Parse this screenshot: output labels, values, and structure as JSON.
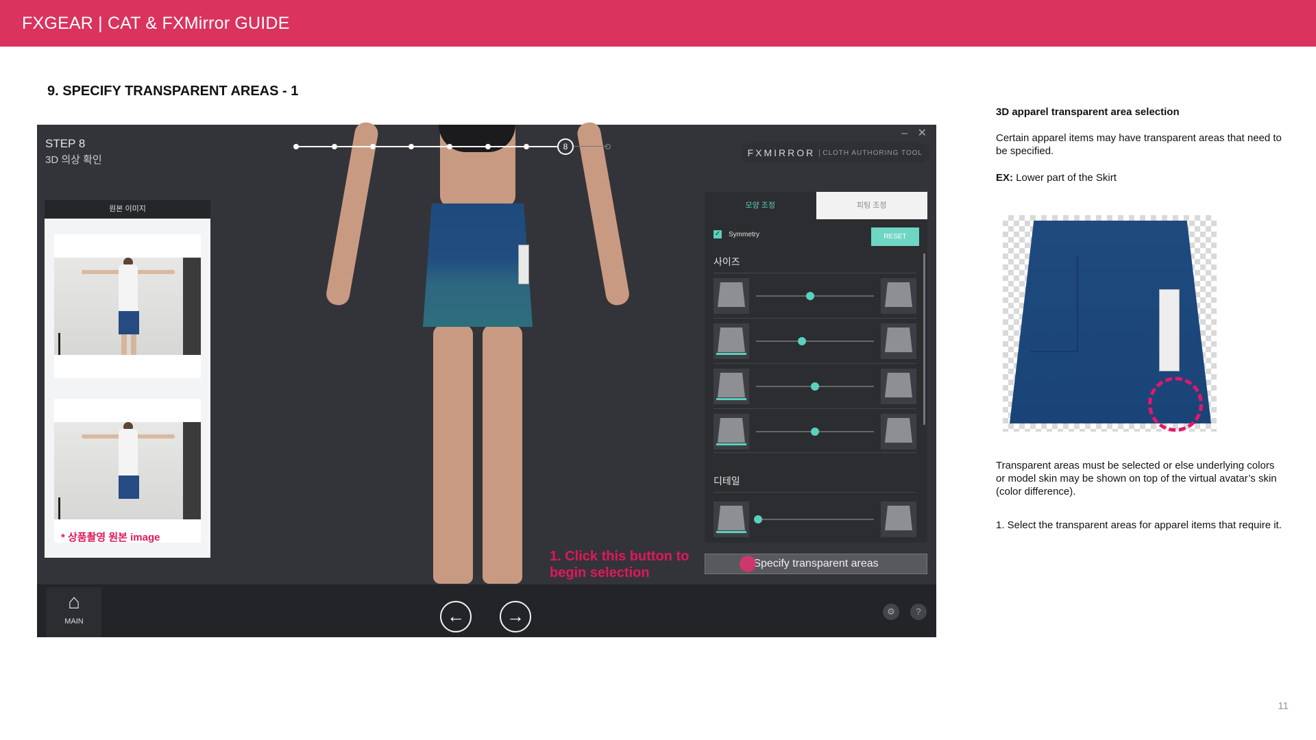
{
  "header": {
    "title": "FXGEAR | CAT & FXMirror GUIDE"
  },
  "section_title": "9. SPECIFY TRANSPARENT AREAS - 1",
  "app": {
    "step_title": "STEP 8",
    "step_subtitle": "3D 의상 확인",
    "current_step": "8",
    "window": {
      "minimize": "–",
      "close": "✕"
    },
    "brand": {
      "name": "FXMIRROR",
      "tagline": "CLOTH AUTHORING TOOL"
    },
    "original_panel": {
      "header": "원본 이미지",
      "caption": "* 상품촬영 원본 image"
    },
    "tabs": [
      {
        "label": "모양 조정",
        "active": true
      },
      {
        "label": "피팅 조정",
        "active": false
      }
    ],
    "symmetry_label": "Symmetry",
    "symmetry_checked": true,
    "reset_label": "RESET",
    "sections": {
      "size": "사이즈",
      "detail": "디테일"
    },
    "sliders": [
      {
        "value": 0.46
      },
      {
        "value": 0.39
      },
      {
        "value": 0.5
      },
      {
        "value": 0.5
      },
      {
        "value": 0.02
      }
    ],
    "specify_button": "Specify transparent areas",
    "callout": "1. Click this button to begin selection",
    "bottom": {
      "home_label": "MAIN",
      "home_icon": "home-icon",
      "prev_icon": "arrow-left-icon",
      "next_icon": "arrow-right-icon",
      "settings_icon": "gear-icon",
      "help_label": "?"
    },
    "accent_color": "#5ad1c0"
  },
  "info": {
    "heading": "3D apparel transparent area selection",
    "p1": "Certain apparel items may have transparent areas that need to be specified.",
    "ex_label": "EX:",
    "ex_text": "Lower part of the Skirt",
    "p2": "Transparent areas must be selected or else underlying colors or model skin may be shown on top of the virtual avatar’s skin (color difference).",
    "p3": "1. Select the transparent areas for apparel items that require it."
  },
  "page_number": "11",
  "colors": {
    "brand": "#d9335e",
    "highlight": "#e6156b"
  }
}
